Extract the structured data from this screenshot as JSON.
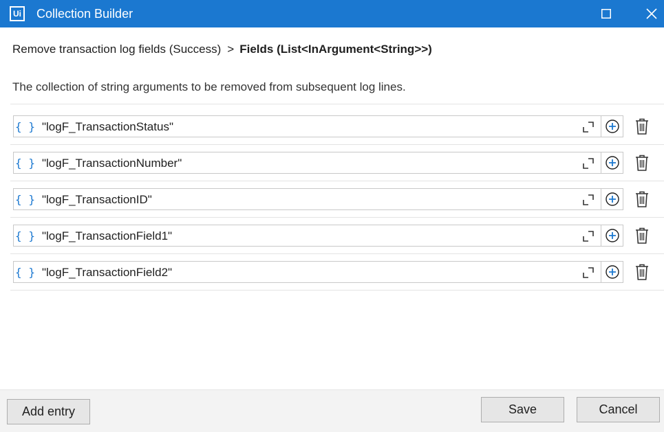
{
  "window": {
    "logo_text": "Ui",
    "title": "Collection Builder"
  },
  "breadcrumb": {
    "parent": "Remove transaction log fields (Success)",
    "separator": ">",
    "current": "Fields (List<InArgument<String>>)"
  },
  "description": "The collection of string arguments to be removed from subsequent log lines.",
  "entries": [
    {
      "value": "\"logF_TransactionStatus\""
    },
    {
      "value": "\"logF_TransactionNumber\""
    },
    {
      "value": "\"logF_TransactionID\""
    },
    {
      "value": "\"logF_TransactionField1\""
    },
    {
      "value": "\"logF_TransactionField2\""
    }
  ],
  "icons": {
    "brace": "{ }",
    "expand": "expand-icon",
    "add": "plus-circle-icon",
    "delete": "trash-icon"
  },
  "footer": {
    "add_entry": "Add entry",
    "save": "Save",
    "cancel": "Cancel"
  },
  "colors": {
    "titlebar": "#1b78d0",
    "accent": "#1b78d0"
  }
}
